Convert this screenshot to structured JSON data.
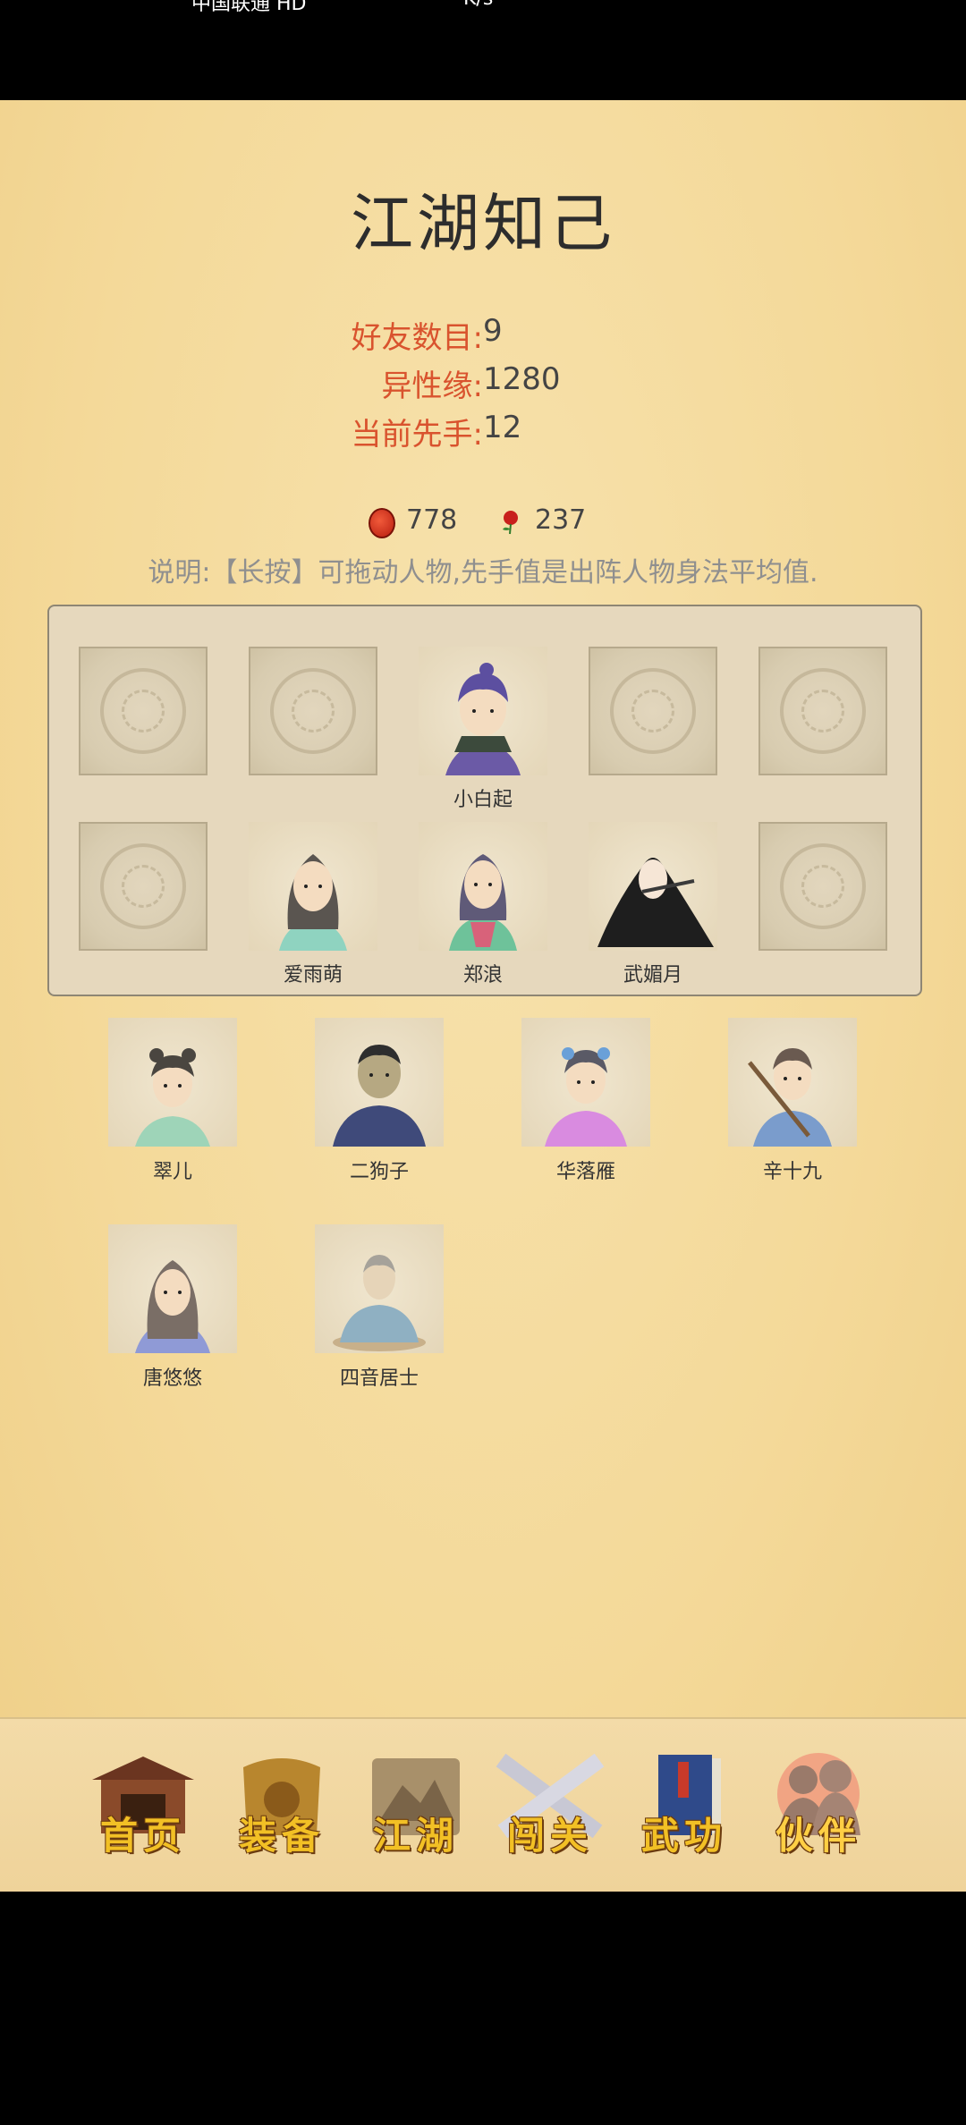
{
  "status_bar": {
    "carrier": "中国联通 HD",
    "center": "K/s",
    "right": ""
  },
  "title": "江湖知己",
  "stats": [
    {
      "label": "好友数目:",
      "value": "9"
    },
    {
      "label": "异性缘:",
      "value": "1280"
    },
    {
      "label": "当前先手:",
      "value": "12"
    }
  ],
  "currency": {
    "coins": "778",
    "roses": "237"
  },
  "note": "说明:【长按】可拖动人物,先手值是出阵人物身法平均值.",
  "formation": {
    "row1": [
      {
        "filled": false,
        "name": ""
      },
      {
        "filled": false,
        "name": ""
      },
      {
        "filled": true,
        "name": "小白起"
      },
      {
        "filled": false,
        "name": ""
      },
      {
        "filled": false,
        "name": ""
      }
    ],
    "row2": [
      {
        "filled": false,
        "name": ""
      },
      {
        "filled": true,
        "name": "爱雨萌"
      },
      {
        "filled": true,
        "name": "郑浪"
      },
      {
        "filled": true,
        "name": "武媚月"
      },
      {
        "filled": false,
        "name": ""
      }
    ]
  },
  "bench": [
    {
      "name": "翠儿"
    },
    {
      "name": "二狗子"
    },
    {
      "name": "华落雁"
    },
    {
      "name": "辛十九"
    },
    {
      "name": "唐悠悠"
    },
    {
      "name": "四音居士"
    }
  ],
  "nav": [
    {
      "label": "首页",
      "icon": "house-icon"
    },
    {
      "label": "装备",
      "icon": "armor-icon"
    },
    {
      "label": "江湖",
      "icon": "scroll-icon"
    },
    {
      "label": "闯关",
      "icon": "swords-icon"
    },
    {
      "label": "武功",
      "icon": "book-icon"
    },
    {
      "label": "伙伴",
      "icon": "partners-icon",
      "active": true
    }
  ]
}
